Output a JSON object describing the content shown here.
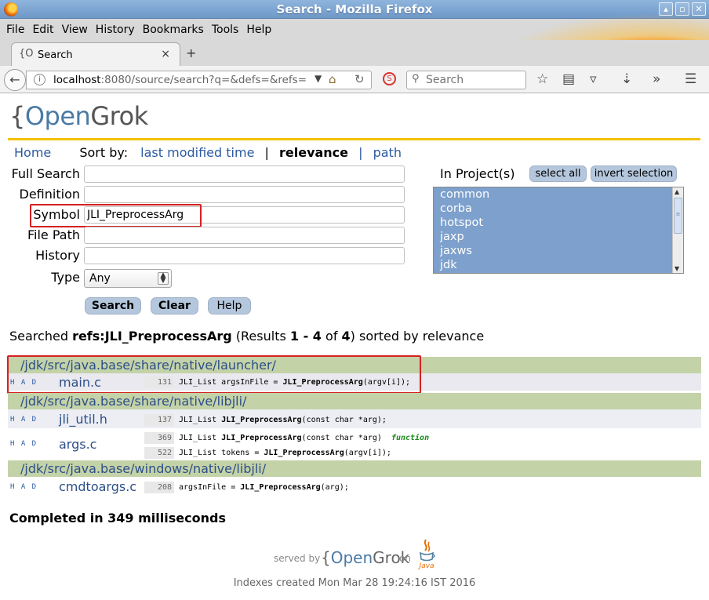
{
  "window": {
    "title": "Search - Mozilla Firefox",
    "buttons": [
      "▴",
      "▫",
      "✕"
    ]
  },
  "menu": [
    "File",
    "Edit",
    "View",
    "History",
    "Bookmarks",
    "Tools",
    "Help"
  ],
  "tab": {
    "favicon": "{O",
    "label": "Search",
    "close": "×",
    "new_tab": "+"
  },
  "nav": {
    "url_host": "localhost",
    "url_rest": ":8080/source/search?q=&defs=&refs=",
    "search_placeholder": "Search"
  },
  "page": {
    "logo_brace": "{",
    "logo_open": "Open",
    "logo_grok": "Grok",
    "home": "Home",
    "sort_by": "Sort by:",
    "sort_options": [
      "last modified time",
      "relevance",
      "path"
    ],
    "sort_sep": "|",
    "fields": {
      "full_search": {
        "label": "Full Search",
        "value": ""
      },
      "definition": {
        "label": "Definition",
        "value": ""
      },
      "symbol": {
        "label": "Symbol",
        "value": "JLI_PreprocessArg"
      },
      "file_path": {
        "label": "File Path",
        "value": ""
      },
      "history": {
        "label": "History",
        "value": ""
      },
      "type": {
        "label": "Type",
        "value": "Any"
      }
    },
    "buttons": {
      "search": "Search",
      "clear": "Clear",
      "help": "Help"
    },
    "projects": {
      "label": "In Project(s)",
      "select_all": "select all",
      "invert_selection": "invert selection",
      "items": [
        "common",
        "corba",
        "hotspot",
        "jaxp",
        "jaxws",
        "jdk"
      ]
    },
    "summary": {
      "prefix": "Searched ",
      "query": "refs:JLI_PreprocessArg",
      "mid": " (Results ",
      "range": "1 - 4",
      "of": " of ",
      "total": "4",
      "suffix": ") sorted by relevance"
    },
    "results": [
      {
        "dir": "/jdk/src/java.base/share/native/launcher/",
        "files": [
          {
            "had": "H A D",
            "name": "main.c",
            "lines": [
              {
                "num": "131",
                "pre": "JLI_List argsInFile = ",
                "sym": "JLI_PreprocessArg",
                "post": "(argv[i]);"
              }
            ]
          }
        ]
      },
      {
        "dir": "/jdk/src/java.base/share/native/libjli/",
        "files": [
          {
            "had": "H A D",
            "name": "jli_util.h",
            "lines": [
              {
                "num": "137",
                "pre": "JLI_List ",
                "sym": "JLI_PreprocessArg",
                "post": "(const char *arg);"
              }
            ]
          },
          {
            "had": "H A D",
            "name": "args.c",
            "lines": [
              {
                "num": "369",
                "pre": "JLI_List ",
                "sym": "JLI_PreprocessArg",
                "post": "(const char *arg)  ",
                "tag": "function"
              },
              {
                "num": "522",
                "pre": "JLI_List tokens = ",
                "sym": "JLI_PreprocessArg",
                "post": "(argv[i]);"
              }
            ]
          }
        ]
      },
      {
        "dir": "/jdk/src/java.base/windows/native/libjli/",
        "files": [
          {
            "had": "H A D",
            "name": "cmdtoargs.c",
            "lines": [
              {
                "num": "208",
                "pre": "argsInFile = ",
                "sym": "JLI_PreprocessArg",
                "post": "(arg);"
              }
            ]
          }
        ]
      }
    ],
    "completed": "Completed in 349 milliseconds",
    "footer": {
      "served_by": "served by",
      "on": "on",
      "java_word": "Java",
      "indexes": "Indexes created Mon Mar 28 19:24:16 IST 2016"
    }
  },
  "colors": {
    "accent_blue": "#2c5aa0",
    "directory_bar": "#c4d2a8",
    "highlight_red": "#d62020",
    "project_list": "#7da0cc",
    "logo_rule": "#f3c100"
  }
}
